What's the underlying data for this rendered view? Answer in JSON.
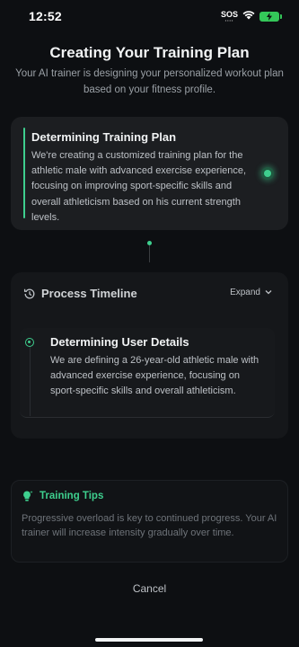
{
  "status_bar": {
    "time": "12:52",
    "sos": "SOS",
    "battery_color": "#34c759"
  },
  "header": {
    "title": "Creating Your Training Plan",
    "subtitle": "Your AI trainer is designing your personalized workout plan based on your fitness profile."
  },
  "current_step": {
    "title": "Determining Training Plan",
    "description": "We're creating a customized training plan for the athletic male with advanced exercise experience, focusing on improving sport-specific skills and overall athleticism based on his current strength levels."
  },
  "timeline": {
    "title": "Process Timeline",
    "expand_label": "Expand",
    "items": [
      {
        "title": "Determining User Details",
        "description": "We are defining a 26-year-old athletic male with advanced exercise experience, focusing on sport-specific skills and overall athleticism."
      }
    ]
  },
  "tips": {
    "title": "Training Tips",
    "body": "Progressive overload is key to continued progress. Your AI trainer will increase intensity gradually over time."
  },
  "actions": {
    "cancel_label": "Cancel"
  },
  "colors": {
    "accent": "#3ecf8e",
    "background": "#0d0f12"
  }
}
